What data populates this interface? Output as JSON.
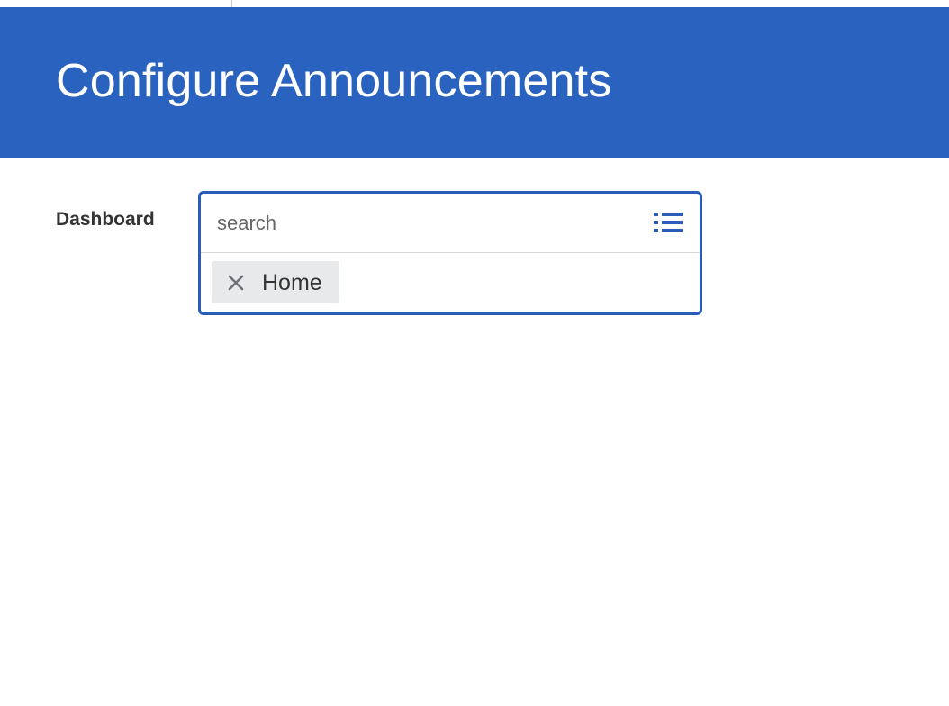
{
  "header": {
    "title": "Configure Announcements",
    "background_color": "#2a63bf"
  },
  "form": {
    "dashboard_label": "Dashboard",
    "search": {
      "placeholder": "search",
      "value": "",
      "icon": "list-icon"
    },
    "selected_items": [
      {
        "label": "Home",
        "remove_icon": "close-icon"
      }
    ],
    "accent_color": "#2a5cb8"
  }
}
